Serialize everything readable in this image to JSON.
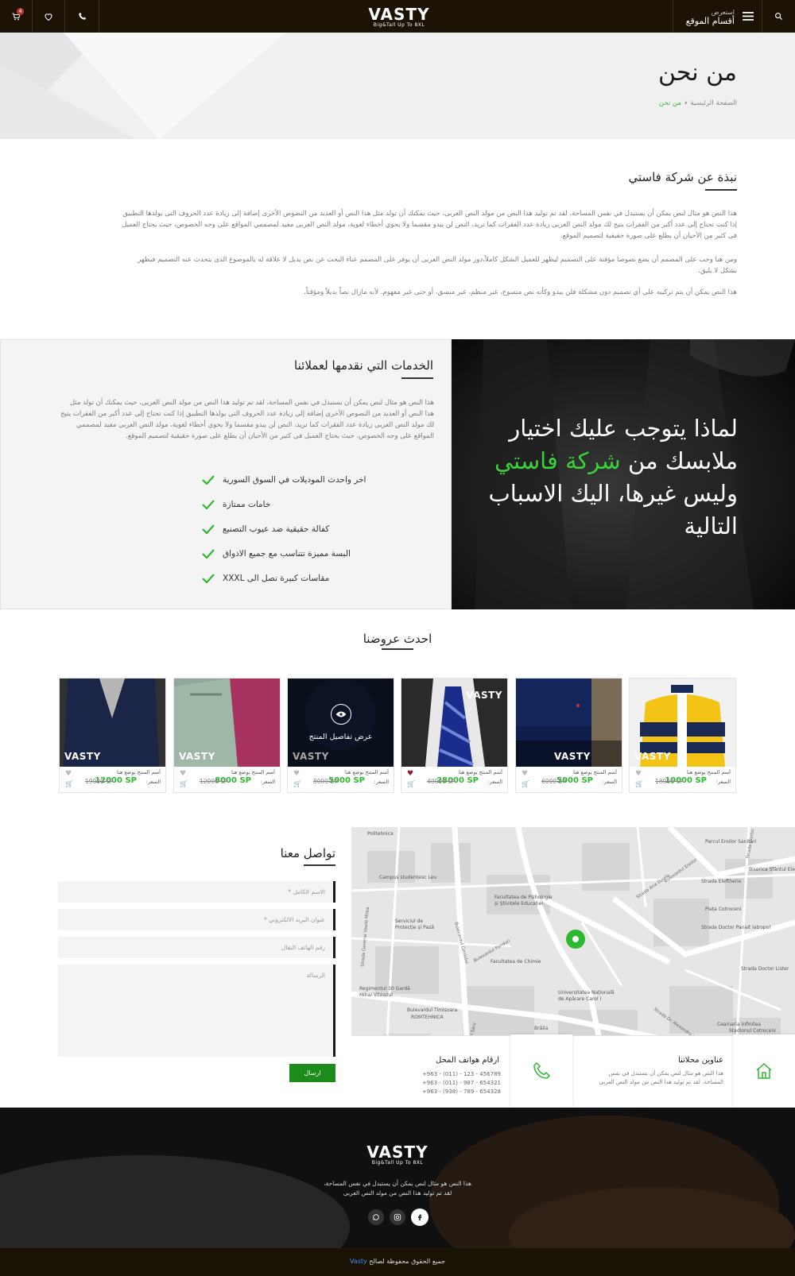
{
  "header": {
    "logo": "VASTY",
    "logo_sub": "Big&Tall Up To 8XL",
    "cart_count": "4",
    "menu_top": "استعرض",
    "menu_bottom": "أقسام الموقع",
    "icons": [
      "cart-icon",
      "heart-icon",
      "phone-icon",
      "menu-icon",
      "search-icon"
    ]
  },
  "page_title": {
    "title": "من نحن",
    "breadcrumb_home": "الصفحة الرئيسية",
    "breadcrumb_sep": "‹",
    "breadcrumb_current": "من نحن"
  },
  "about": {
    "heading": "نبذة عن شركة فاستي",
    "p1": "هذا النص هو مثال لنص يمكن أن يستبدل في نفس المساحة، لقد تم توليد هذا النص من مولد النص العربى، حيث يمكنك أن تولد مثل هذا النص أو العديد من النصوص الأخرى إضافة إلى زيادة عدد الحروف التى يولدها التطبيق إذا كنت تحتاج إلى عدد أكبر من الفقرات يتيح لك مولد النص العربى زيادة عدد الفقرات كما تريد، النص لن يبدو مقسما ولا يحوي أخطاء لغوية، مولد النص العربى مفيد لمصممي المواقع على وجه الخصوص، حيث يحتاج العميل فى كثير من الأحيان أن يطلع على صورة حقيقية لتصميم الموقع.",
    "p2": "ومن هنا وجب على المصمم أن يضع نصوصا مؤقتة على التصميم ليظهر للعميل الشكل كاملاً،دور مولد النص العربى أن يوفر على المصمم عناء البحث عن نص بديل لا علاقة له بالموضوع الذى يتحدث عنه التصميم فيظهر بشكل لا يليق.",
    "p3": "هذا النص يمكن أن يتم تركيبه على أي تصميم دون مشكلة فلن يبدو وكأنه نص منسوخ، غير منظم، غير منسق، أو حتى غير مفهوم. لأنه مازال نصاً بديلاً ومؤقتاً."
  },
  "why": {
    "line1": "لماذا يتوجب عليك اختيار",
    "line2_a": "ملابسك من ",
    "line2_b": "شركة فاستي",
    "line3": "وليس غيرها، اليك الاسباب",
    "line4": "التالية",
    "accent_color": "#3ad13a"
  },
  "services": {
    "heading": "الخدمات التي نقدمها لعملائنا",
    "paragraph": "هذا النص هو مثال لنص يمكن أن يستبدل في نفس المساحة، لقد تم توليد هذا النص من مولد النص العربى، حيث يمكنك أن تولد مثل هذا النص أو العديد من النصوص الأخرى إضافة إلى زيادة عدد الحروف التى يولدها التطبيق إذا كنت تحتاج إلى عدد أكبر من الفقرات يتيح لك مولد النص العربى زيادة عدد الفقرات كما تريد، النص لن يبدو مقسما ولا يحوي أخطاء لغوية، مولد النص العربى مفيد لمصممي المواقع على وجه الخصوص، حيث يحتاج العميل فى كثير من الأحيان أن يطلع على صورة حقيقية لتصميم الموقع.",
    "items": [
      "اخر واحدث الموديلات في السوق السورية",
      "خامات ممتازة",
      "كفالة حقيقية ضد عيوب التصنيع",
      "البسة مميزة تتناسب مع جميع الاذواق",
      "مقاسات كبيرة تصل الى XXXL"
    ]
  },
  "offers": {
    "heading": "احدث عروضنا",
    "view_details": "عرض تفاصيل المنتج",
    "products": [
      {
        "name": "أسم المنتج يوضع هنا",
        "label": "السعر:",
        "price": "10000 SP",
        "old": "18000 SP",
        "watermark": "VASTY",
        "liked": false
      },
      {
        "name": "أسم المنتج يوضع هنا",
        "label": "السعر:",
        "price": "5000 SP",
        "old": "6000 SP",
        "watermark": "VASTY",
        "liked": false
      },
      {
        "name": "أسم المنتج يوضع هنا",
        "label": "السعر:",
        "price": "28000 SP",
        "old": "40000 SP",
        "watermark": "VASTY",
        "liked": true
      },
      {
        "name": "أسم المنتج يوضع هنا",
        "label": "السعر:",
        "price": "5000 SP",
        "old": "8000 SP",
        "watermark": "VASTY",
        "liked": false
      },
      {
        "name": "أسم المنتج يوضع هنا",
        "label": "السعر:",
        "price": "8000 SP",
        "old": "12000 SP",
        "watermark": "VASTY",
        "liked": false
      },
      {
        "name": "أسم المنتج يوضع هنا",
        "label": "السعر:",
        "price": "12000 SP",
        "old": "19000 SP",
        "watermark": "VASTY",
        "liked": false
      }
    ]
  },
  "contact": {
    "heading": "تواصل معنا",
    "name_ph": "الاسم الكامل *",
    "email_ph": "عنوان البريد الالكتروني *",
    "phone_ph": "رقم الهاتف النقال",
    "message_ph": "الرسالة",
    "send": "ارسال"
  },
  "map": {
    "labels": [
      "Parcul Eroilor Sanitari",
      "Biserica Sfântul Ele",
      "Strada Eleftherie",
      "Piața Cotroceni",
      "Strada Doctor Panait Iatropol",
      "Strada Doctor Lister",
      "Campus studențesc Leu",
      "Facultatea de Psihologie și Științele Educației",
      "Serviciul de Protecție și Pază",
      "Facultatea de Chimie",
      "Regimentul 30 Gardă Mihai Viteazul",
      "Bulevardul Timișoara",
      "ROMTEHNICA",
      "Universitatea Națională de Apărare Carol I",
      "Ceainaria Infinitea",
      "Stadionul Cotroceni",
      "Strada General Vasile Milea",
      "Bulevardul Geniului",
      "Strada Ana Davila",
      "Bulevardul Eroilor",
      "Strada Doctor Carol Davila",
      "Strada Dr. Alexandru Vitzu",
      "Bulevardul Panduri",
      "Drumul Sării",
      "Politehnica",
      "Brăila"
    ]
  },
  "addresses": {
    "title": "عناوين محلاتنا",
    "text": "هذا النص هو مثال لنص يمكن أن يستبدل في نفس المساحة، لقد تم توليد هذا النص من مولد النص العربى"
  },
  "phones": {
    "title": "ارقام هواتف المحل",
    "list": [
      "+963 - (011) - 123 - 456789",
      "+963 - (011) - 987 - 654321",
      "+963 - (938) - 789 - 654328"
    ]
  },
  "footer": {
    "logo": "VASTY",
    "logo_sub": "Big&Tall Up To 8XL",
    "line1": "هذا النص هو مثال لنص يمكن أن يستبدل في نفس المساحة،",
    "line2": "لقد تم توليد هذا النص من مولد النص العربى",
    "social": [
      "whatsapp-icon",
      "instagram-icon",
      "facebook-icon"
    ],
    "copyright_prefix": "جميع الحقوق محفوظة لصالح ",
    "copyright_brand": "Vasty"
  }
}
